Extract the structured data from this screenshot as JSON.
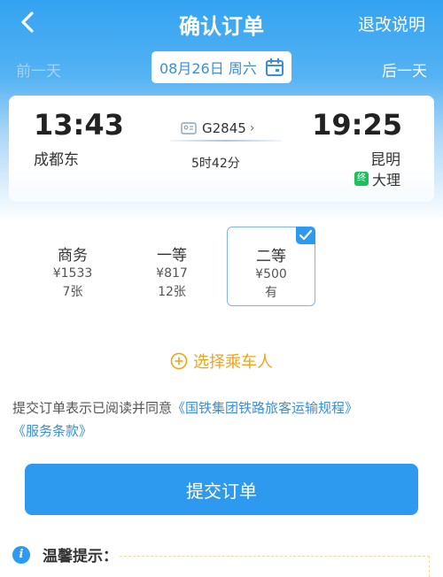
{
  "nav": {
    "title": "确认订单",
    "refund_label": "退改说明"
  },
  "date_bar": {
    "prev_label": "前一天",
    "date_label": "08月26日 周六",
    "next_label": "后一天"
  },
  "trip": {
    "departure": {
      "time": "13:43",
      "station": "成都东"
    },
    "arrival": {
      "time": "19:25",
      "station": "昆明"
    },
    "terminal": {
      "badge": "终",
      "station": "大理"
    },
    "train_no": "G2845",
    "chevron": "›",
    "duration": "5时42分"
  },
  "seats": [
    {
      "name": "商务",
      "price": "¥1533",
      "count": "7张",
      "selected": false
    },
    {
      "name": "一等",
      "price": "¥817",
      "count": "12张",
      "selected": false
    },
    {
      "name": "二等",
      "price": "¥500",
      "count": "有",
      "selected": true
    }
  ],
  "choose_passenger": "选择乘车人",
  "agreement": {
    "prefix": "提交订单表示已阅读并同意",
    "link1": "《国铁集团铁路旅客运输规程》",
    "link2": "《服务条款》"
  },
  "submit_label": "提交订单",
  "tips": {
    "icon": "i",
    "title": "温馨提示："
  },
  "colors": {
    "primary": "#2d9af0",
    "accent": "#f0a31a",
    "terminal_badge": "#1fbf5d"
  }
}
